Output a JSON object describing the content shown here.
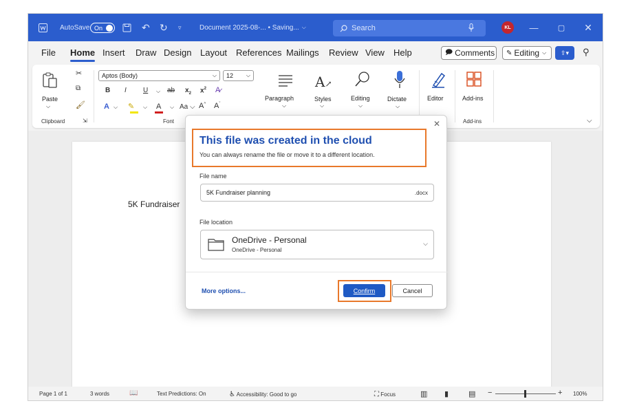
{
  "titlebar": {
    "autosave_label": "AutoSave",
    "autosave_state": "On",
    "doc_title": "Document 2025-08-... • Saving...",
    "search_placeholder": "Search",
    "avatar_initials": "KL",
    "accent": "#2b5dcd"
  },
  "menu": {
    "items": [
      "File",
      "Home",
      "Insert",
      "Draw",
      "Design",
      "Layout",
      "References",
      "Mailings",
      "Review",
      "View",
      "Help"
    ],
    "active": "Home",
    "comments_label": "Comments",
    "editing_label": "Editing"
  },
  "ribbon": {
    "paste_label": "Paste",
    "clipboard_label": "Clipboard",
    "font_name": "Aptos (Body)",
    "font_size": "12",
    "font_label": "Font",
    "paragraph_label": "Paragraph",
    "styles_label": "Styles",
    "editing_label": "Editing",
    "dictate_label": "Dictate",
    "editor_label": "Editor",
    "addins_label": "Add-ins",
    "addins_group_label": "Add-ins",
    "bold": "B",
    "italic": "I",
    "underline": "U",
    "strike": "ab",
    "sub": "x",
    "sup": "x",
    "font_case": "Aa",
    "grow": "A",
    "shrink": "A",
    "font_color": "A",
    "effects": "A"
  },
  "document": {
    "visible_text": "5K Fundraiser"
  },
  "dialog": {
    "title": "This file was created in the cloud",
    "subtitle": "You can always rename the file or move it to a different location.",
    "file_name_label": "File name",
    "file_name_value": "5K Fundraiser planning",
    "file_ext": ".docx",
    "file_location_label": "File location",
    "location_name": "OneDrive - Personal",
    "location_sub": "OneDrive - Personal",
    "more_options": "More options...",
    "confirm": "Confirm",
    "cancel": "Cancel",
    "highlight_color": "#e8782a"
  },
  "status": {
    "page": "Page 1 of 1",
    "words": "3 words",
    "text_predictions": "Text Predictions: On",
    "accessibility": "Accessibility: Good to go",
    "focus": "Focus",
    "zoom": "100%",
    "zoom_minus": "−",
    "zoom_plus": "+"
  }
}
